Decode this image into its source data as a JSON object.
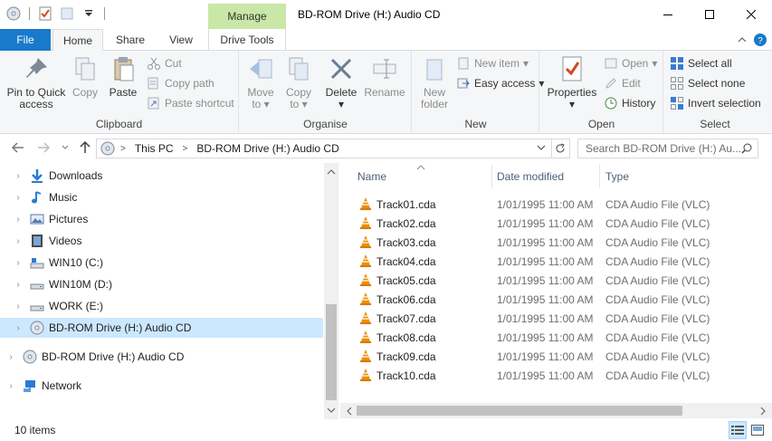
{
  "window": {
    "title": "BD-ROM Drive (H:) Audio CD",
    "context_tab": "Manage"
  },
  "tabs": [
    "File",
    "Home",
    "Share",
    "View",
    "Drive Tools"
  ],
  "ribbon": {
    "clipboard": {
      "label": "Clipboard",
      "pin_line1": "Pin to Quick",
      "pin_line2": "access",
      "copy": "Copy",
      "paste": "Paste",
      "cut": "Cut",
      "copy_path": "Copy path",
      "paste_shortcut": "Paste shortcut"
    },
    "organise": {
      "label": "Organise",
      "move_to_1": "Move",
      "move_to_2": "to",
      "copy_to_1": "Copy",
      "copy_to_2": "to",
      "delete": "Delete",
      "rename": "Rename"
    },
    "new": {
      "label": "New",
      "new_folder_1": "New",
      "new_folder_2": "folder",
      "new_item": "New item",
      "easy_access": "Easy access"
    },
    "open": {
      "label": "Open",
      "properties": "Properties",
      "open": "Open",
      "edit": "Edit",
      "history": "History"
    },
    "select": {
      "label": "Select",
      "select_all": "Select all",
      "select_none": "Select none",
      "invert_selection": "Invert selection"
    }
  },
  "address": {
    "crumbs": [
      "This PC",
      "BD-ROM Drive (H:) Audio CD"
    ],
    "search_placeholder": "Search BD-ROM Drive (H:) Au..."
  },
  "nav": {
    "items": [
      {
        "label": "Downloads",
        "icon": "downloads-icon"
      },
      {
        "label": "Music",
        "icon": "music-icon"
      },
      {
        "label": "Pictures",
        "icon": "pictures-icon"
      },
      {
        "label": "Videos",
        "icon": "videos-icon"
      },
      {
        "label": "WIN10 (C:)",
        "icon": "drive-icon"
      },
      {
        "label": "WIN10M (D:)",
        "icon": "drive-icon"
      },
      {
        "label": "WORK (E:)",
        "icon": "drive-icon"
      },
      {
        "label": "BD-ROM Drive (H:) Audio CD",
        "icon": "cd-icon",
        "selected": true
      }
    ],
    "root_items": [
      {
        "label": "BD-ROM Drive (H:) Audio CD",
        "icon": "cd-icon"
      },
      {
        "label": "Network",
        "icon": "network-icon"
      }
    ]
  },
  "files": {
    "columns": [
      "Name",
      "Date modified",
      "Type"
    ],
    "rows": [
      {
        "name": "Track01.cda",
        "date": "1/01/1995 11:00 AM",
        "type": "CDA Audio File (VLC)"
      },
      {
        "name": "Track02.cda",
        "date": "1/01/1995 11:00 AM",
        "type": "CDA Audio File (VLC)"
      },
      {
        "name": "Track03.cda",
        "date": "1/01/1995 11:00 AM",
        "type": "CDA Audio File (VLC)"
      },
      {
        "name": "Track04.cda",
        "date": "1/01/1995 11:00 AM",
        "type": "CDA Audio File (VLC)"
      },
      {
        "name": "Track05.cda",
        "date": "1/01/1995 11:00 AM",
        "type": "CDA Audio File (VLC)"
      },
      {
        "name": "Track06.cda",
        "date": "1/01/1995 11:00 AM",
        "type": "CDA Audio File (VLC)"
      },
      {
        "name": "Track07.cda",
        "date": "1/01/1995 11:00 AM",
        "type": "CDA Audio File (VLC)"
      },
      {
        "name": "Track08.cda",
        "date": "1/01/1995 11:00 AM",
        "type": "CDA Audio File (VLC)"
      },
      {
        "name": "Track09.cda",
        "date": "1/01/1995 11:00 AM",
        "type": "CDA Audio File (VLC)"
      },
      {
        "name": "Track10.cda",
        "date": "1/01/1995 11:00 AM",
        "type": "CDA Audio File (VLC)"
      }
    ]
  },
  "status": {
    "count": "10 items"
  },
  "colors": {
    "file_tab": "#1979ca",
    "manage_tab": "#c9e7a6",
    "selection": "#cce8ff",
    "vlc_orange": "#f08c00"
  }
}
